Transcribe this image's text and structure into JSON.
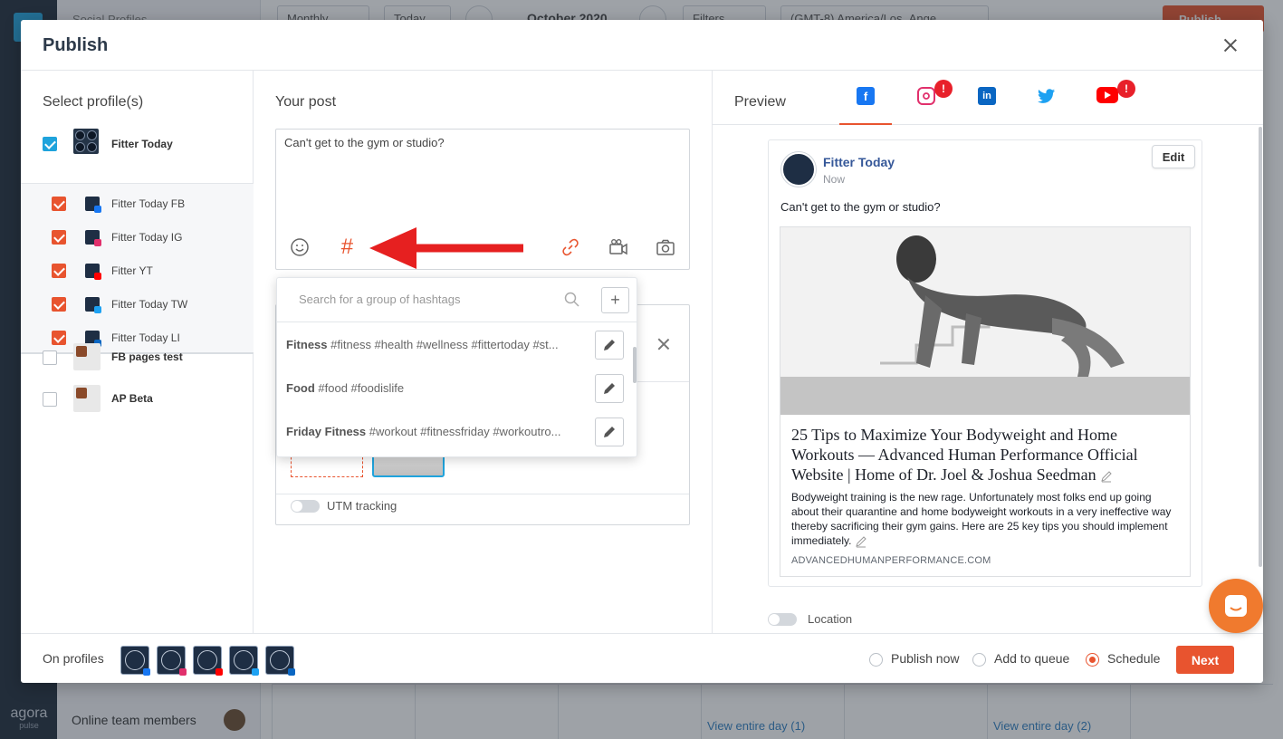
{
  "background": {
    "panel_title": "Social Profiles",
    "view_select": "Monthly",
    "today_label": "Today",
    "month_label": "October 2020",
    "filters_label": "Filters",
    "timezone_select": "(GMT-8) America/Los_Ange",
    "publish_label": "Publish",
    "online_team_label": "Online team members",
    "view_entire_day_1": "View entire day (1)",
    "view_entire_day_2": "View entire day (2)",
    "brand_name": "agora",
    "brand_sub": "pulse"
  },
  "modal": {
    "title": "Publish",
    "profiles": {
      "heading": "Select profile(s)",
      "group": {
        "name": "Fitter Today",
        "checked": true
      },
      "children": [
        {
          "name": "Fitter Today FB",
          "network": "facebook",
          "checked": true
        },
        {
          "name": "Fitter Today IG",
          "network": "instagram",
          "checked": true
        },
        {
          "name": "Fitter YT",
          "network": "youtube",
          "checked": true
        },
        {
          "name": "Fitter Today TW",
          "network": "twitter",
          "checked": true
        },
        {
          "name": "Fitter Today LI",
          "network": "linkedin",
          "checked": true
        }
      ],
      "other": [
        {
          "name": "FB pages test",
          "checked": false
        },
        {
          "name": "AP Beta",
          "checked": false
        }
      ]
    },
    "post": {
      "heading": "Your post",
      "text": "Can't get to the gym or studio?",
      "utm_label": "UTM tracking"
    },
    "hashtags": {
      "search_placeholder": "Search for a group of hashtags",
      "add_label": "+",
      "groups": [
        {
          "name": "Fitness",
          "tags": "#fitness #health #wellness #fittertoday #st..."
        },
        {
          "name": "Food",
          "tags": "#food #foodislife"
        },
        {
          "name": "Friday Fitness",
          "tags": "#workout #fitnessfriday #workoutro..."
        }
      ]
    },
    "preview": {
      "heading": "Preview",
      "tabs": [
        "facebook",
        "instagram",
        "linkedin",
        "twitter",
        "youtube"
      ],
      "alert_mark": "!",
      "card": {
        "page_name": "Fitter Today",
        "time": "Now",
        "edit_label": "Edit",
        "text": "Can't get to the gym or studio?",
        "link_title": "25 Tips to Maximize Your Bodyweight and Home Workouts — Advanced Human Performance Official Website | Home of Dr. Joel & Joshua Seedman",
        "link_desc": "Bodyweight training is the new rage. Unfortunately most folks end up going about their quarantine and home bodyweight workouts in a very ineffective way thereby sacrificing their gym gains. Here are 25 key tips you should implement immediately.",
        "link_domain": "ADVANCEDHUMANPERFORMANCE.COM"
      },
      "location_label": "Location"
    },
    "footer": {
      "on_profiles_label": "On profiles",
      "options": [
        "Publish now",
        "Add to queue",
        "Schedule"
      ],
      "selected_option": "Schedule",
      "next_label": "Next"
    }
  },
  "colors": {
    "accent": "#e8542f",
    "blue_check": "#1fa3dc",
    "facebook": "#1877f2",
    "instagram": "#e1306c",
    "linkedin": "#0a66c2",
    "twitter": "#1da1f2",
    "youtube": "#ff0000"
  }
}
